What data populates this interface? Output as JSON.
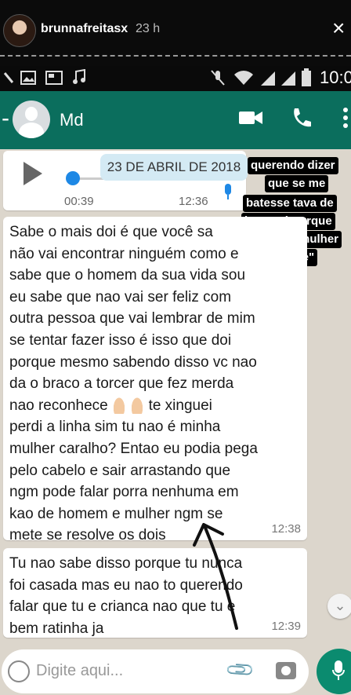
{
  "story": {
    "username": "brunnafreitasx",
    "time": "23 h",
    "close_glyph": "×"
  },
  "status_bar": {
    "clock": "10:0"
  },
  "chat_header": {
    "contact_name": "Md",
    "back_glyph": "-"
  },
  "audio_message": {
    "duration": "00:39",
    "time": "12:36"
  },
  "date_divider": "23 DE ABRIL DE 2018",
  "overlay_caption": {
    "lines": [
      "querendo dizer",
      "que se me",
      "batesse tava de",
      "boa, até porque",
      "eu \"era a mulher",
      "dele\""
    ]
  },
  "messages": [
    {
      "lines": [
        "Sabe o mais doi é que você sa",
        "não vai encontrar ninguém como e",
        "sabe que o homem da sua vida sou",
        "eu sabe que nao vai ser feliz com",
        "outra pessoa que vai lembrar de mim",
        "se tentar fazer isso é isso que doi",
        "porque mesmo sabendo disso vc nao",
        "da o braco a torcer que fez merda",
        "nao reconhece",
        "perdi a linha sim tu nao é minha",
        "mulher caralho? Entao eu podia pega",
        "pelo cabelo e sair arrastando que",
        "ngm pode falar porra nenhuma em",
        "kao de homem e mulher ngm se",
        "mete se resolve os dois"
      ],
      "emoji_line_suffix": "te xinguei",
      "time": "12:38"
    },
    {
      "lines": [
        "Tu nao sabe disso porque tu nunca",
        "foi casada mas eu nao to querendo",
        "falar que tu e crianca nao que tu e",
        "bem ratinha ja"
      ],
      "time": "12:39"
    }
  ],
  "composer": {
    "placeholder": "Digite aqui..."
  },
  "colors": {
    "header_green": "#0b6e5d",
    "chat_background": "#dcd6cc",
    "accent_blue": "#1e88e5",
    "fab_green": "#0b8b6f"
  },
  "icons": [
    "video-call-icon",
    "phone-call-icon",
    "more-menu-icon",
    "play-icon",
    "mic-icon",
    "emoji-icon",
    "attach-clip-icon",
    "camera-icon",
    "scroll-down-icon"
  ]
}
